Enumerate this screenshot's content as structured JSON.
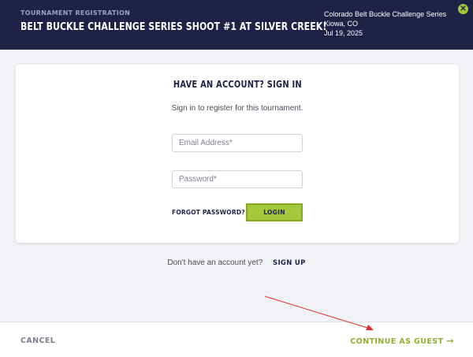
{
  "header": {
    "kicker": "TOURNAMENT REGISTRATION",
    "title": "BELT BUCKLE CHALLENGE SERIES SHOOT #1 AT SILVER CREEK!",
    "series": "Colorado Belt Buckle Challenge Series",
    "location": "Kiowa, CO",
    "date": "Jul 19, 2025",
    "close_glyph": "✕"
  },
  "signin": {
    "heading": "HAVE AN ACCOUNT? SIGN IN",
    "subtitle": "Sign in to register for this tournament.",
    "email_placeholder": "Email Address*",
    "password_placeholder": "Password*",
    "forgot_label": "FORGOT PASSWORD?",
    "login_label": "LOGIN"
  },
  "signup": {
    "prompt": "Don't have an account yet?",
    "link": "SIGN UP"
  },
  "footer": {
    "cancel_label": "CANCEL",
    "guest_label": "CONTINUE AS GUEST",
    "guest_arrow": "→"
  },
  "colors": {
    "header_bg": "#1f2246",
    "accent": "#a5c73a",
    "annotation_arrow": "#e0302a"
  }
}
